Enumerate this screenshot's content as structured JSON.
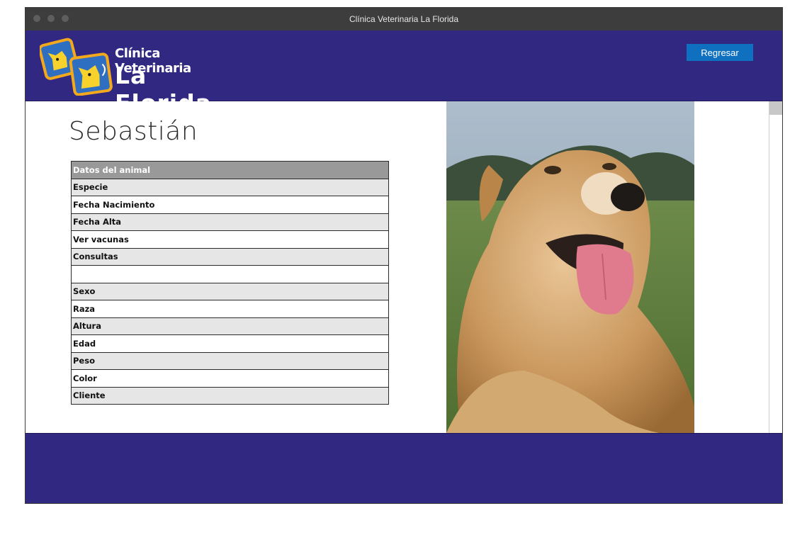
{
  "window": {
    "title": "Clínica Veterinaria La Florida"
  },
  "header": {
    "logo_line1": "Clínica Veterinaria",
    "logo_line2": "La Florida",
    "back_button": "Regresar"
  },
  "pet": {
    "name": "Sebastián",
    "table_header": "Datos del animal",
    "rows": [
      {
        "label": "Especie"
      },
      {
        "label": "Fecha Nacimiento"
      },
      {
        "label": "Fecha Alta"
      },
      {
        "label": "Ver vacunas"
      },
      {
        "label": "Consultas"
      },
      {
        "label": ""
      },
      {
        "label": "Sexo"
      },
      {
        "label": "Raza"
      },
      {
        "label": "Altura"
      },
      {
        "label": "Edad"
      },
      {
        "label": "Peso"
      },
      {
        "label": "Color"
      },
      {
        "label": "Cliente"
      }
    ]
  },
  "colors": {
    "brand": "#312882",
    "button": "#1070c0",
    "table_header": "#999999",
    "row_shade": "#e6e6e6"
  },
  "icons": [
    "dog-logo-icon",
    "scrollbar-thumb"
  ]
}
